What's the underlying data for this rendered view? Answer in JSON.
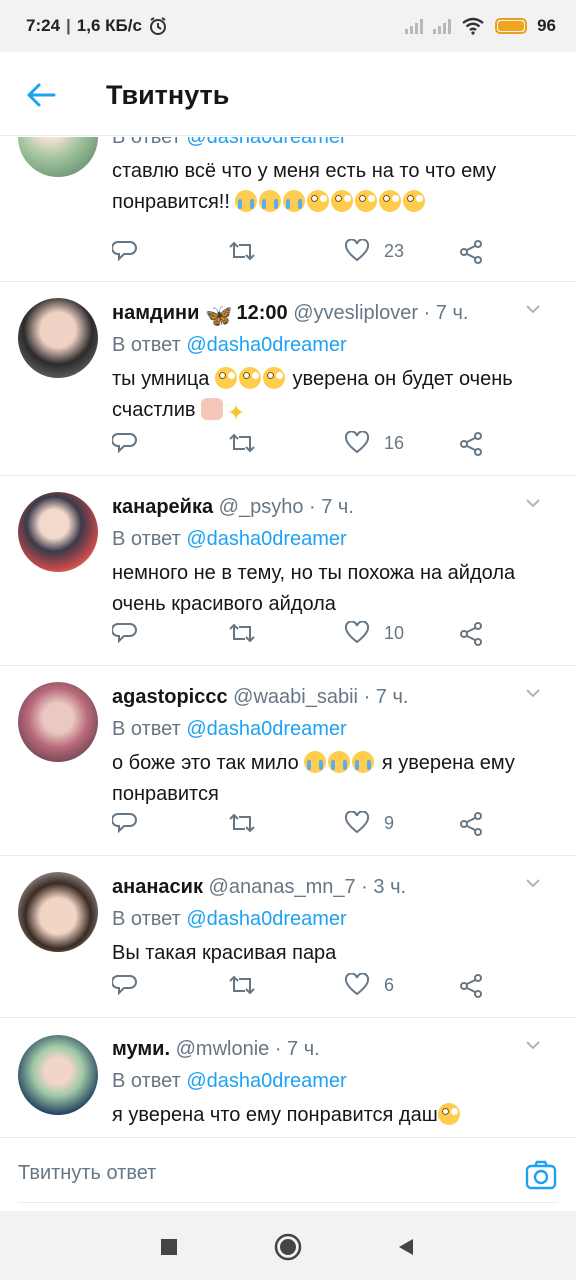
{
  "status_bar": {
    "time": "7:24",
    "network_speed": "1,6 КБ/с",
    "battery_percent": "96",
    "alarm_icon": "alarm-icon",
    "wifi_icon": "wifi-icon"
  },
  "header": {
    "title": "Твитнуть",
    "back_icon": "arrow-left-icon"
  },
  "colors": {
    "accent": "#1da1f2",
    "muted": "#657786",
    "text": "#14171a",
    "divider": "#e6ecf0",
    "battery": "#f0a51f"
  },
  "tweets": [
    {
      "name": "",
      "handle": "",
      "time": "",
      "reply_prefix": "В ответ",
      "reply_mention": "@dasha0dreamer",
      "text_line1": "ставлю всё что у меня есть на то что ему",
      "text_line2": "понравится!!",
      "emojis": [
        "cry",
        "cry",
        "cry",
        "roll",
        "roll",
        "roll",
        "roll",
        "roll"
      ],
      "likes": "23"
    },
    {
      "name": "намдини",
      "name_suffix": "12:00",
      "handle": "@yvesliplover",
      "time": "· 7 ч.",
      "reply_prefix": "В ответ",
      "reply_mention": "@dasha0dreamer",
      "text_line1": "ты умница",
      "text_line1b": "уверена он будет очень",
      "text_line2": "счастлив",
      "likes": "16"
    },
    {
      "name": "канарейка",
      "handle": "@_psyho",
      "time": "· 7 ч.",
      "reply_prefix": "В ответ",
      "reply_mention": "@dasha0dreamer",
      "text_line1": "немного не в тему, но ты похожа на айдола",
      "text_line2": "очень красивого айдола",
      "likes": "10"
    },
    {
      "name": "agastopiccc",
      "handle": "@waabi_sabii",
      "time": "· 7 ч.",
      "reply_prefix": "В ответ",
      "reply_mention": "@dasha0dreamer",
      "text_line1": "о боже это так мило",
      "text_line1b": "я уверена ему",
      "text_line2": "понравится",
      "likes": "9"
    },
    {
      "name": "ананасик",
      "handle": "@ananas_mn_7",
      "time": "· 3 ч.",
      "reply_prefix": "В ответ",
      "reply_mention": "@dasha0dreamer",
      "text_line1": "Вы такая красивая пара",
      "likes": "6"
    },
    {
      "name": "муми.",
      "handle": "@mwlonie",
      "time": "· 7 ч.",
      "reply_prefix": "В ответ",
      "reply_mention": "@dasha0dreamer",
      "text_line1": "я уверена что ему понравится даш"
    }
  ],
  "composer": {
    "placeholder": "Твитнуть ответ",
    "camera_icon": "camera-icon"
  },
  "navbar": {
    "recents_icon": "square-icon",
    "home_icon": "circle-icon",
    "back_icon": "triangle-back-icon"
  }
}
